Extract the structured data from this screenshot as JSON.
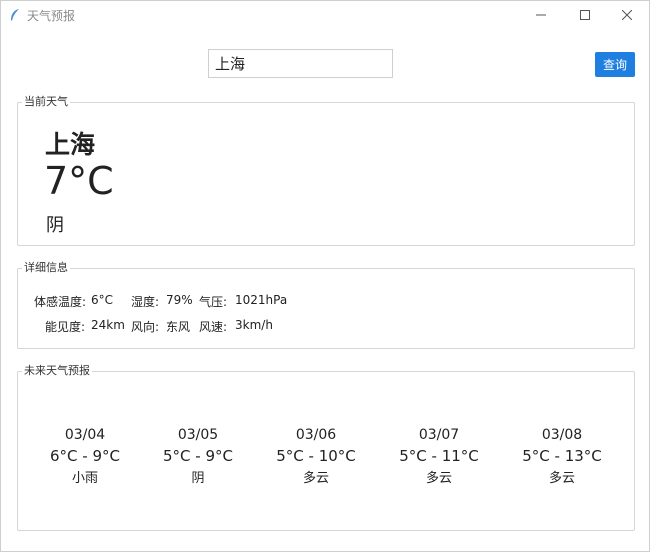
{
  "window": {
    "title": "天气预报",
    "icon": "feather-icon"
  },
  "search": {
    "value": "上海",
    "button_label": "查询"
  },
  "current": {
    "group_title": "当前天气",
    "city": "上海",
    "temperature": "7°C",
    "condition": "阴"
  },
  "details": {
    "group_title": "详细信息",
    "feels_like_label": "体感温度:",
    "feels_like_value": "6°C",
    "humidity_label": "湿度:",
    "humidity_value": "79%",
    "pressure_label": "气压:",
    "pressure_value": "1021hPa",
    "visibility_label": "能见度:",
    "visibility_value": "24km",
    "wind_dir_label": "风向:",
    "wind_dir_value": "东风",
    "wind_speed_label": "风速:",
    "wind_speed_value": "3km/h"
  },
  "forecast": {
    "group_title": "未来天气预报",
    "days": [
      {
        "date": "03/04",
        "range": "6°C - 9°C",
        "condition": "小雨"
      },
      {
        "date": "03/05",
        "range": "5°C - 9°C",
        "condition": "阴"
      },
      {
        "date": "03/06",
        "range": "5°C - 10°C",
        "condition": "多云"
      },
      {
        "date": "03/07",
        "range": "5°C - 11°C",
        "condition": "多云"
      },
      {
        "date": "03/08",
        "range": "5°C - 13°C",
        "condition": "多云"
      }
    ]
  },
  "colors": {
    "accent": "#1e7fe0",
    "border": "#d6d6d6"
  }
}
